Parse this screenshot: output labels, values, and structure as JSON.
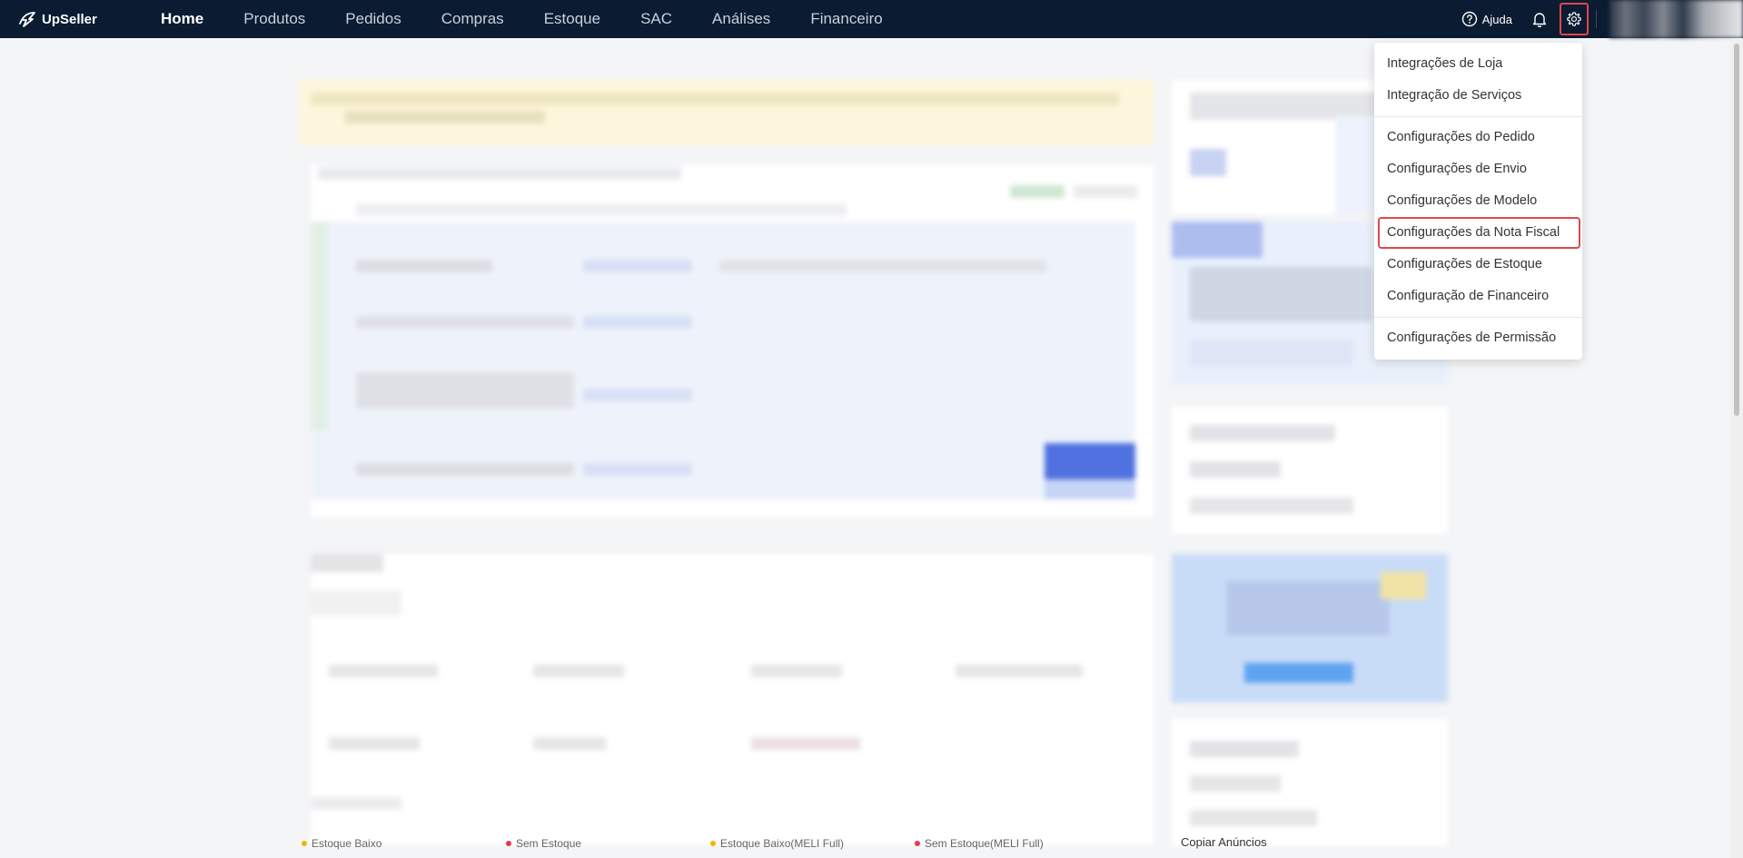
{
  "app": {
    "brand": "UpSeller"
  },
  "nav": {
    "items": [
      {
        "label": "Home",
        "active": true
      },
      {
        "label": "Produtos",
        "active": false
      },
      {
        "label": "Pedidos",
        "active": false
      },
      {
        "label": "Compras",
        "active": false
      },
      {
        "label": "Estoque",
        "active": false
      },
      {
        "label": "SAC",
        "active": false
      },
      {
        "label": "Análises",
        "active": false
      },
      {
        "label": "Financeiro",
        "active": false
      }
    ]
  },
  "topbar": {
    "help_label": "Ajuda"
  },
  "settings_menu": {
    "groups": [
      [
        "Integrações de Loja",
        "Integração de Serviços"
      ],
      [
        "Configurações do Pedido",
        "Configurações de Envio",
        "Configurações de Modelo",
        "Configurações da Nota Fiscal",
        "Configurações de Estoque",
        "Configuração de Financeiro"
      ],
      [
        "Configurações de Permissão"
      ]
    ],
    "highlighted": "Configurações da Nota Fiscal"
  },
  "legend": {
    "items": [
      {
        "label": "Estoque Baixo",
        "color": "#f5b400"
      },
      {
        "label": "Sem Estoque",
        "color": "#e8384f"
      },
      {
        "label": "Estoque Baixo(MELI Full)",
        "color": "#f5b400"
      },
      {
        "label": "Sem Estoque(MELI Full)",
        "color": "#e8384f"
      }
    ]
  },
  "side_link": {
    "label": "Copiar Anúncios"
  },
  "colors": {
    "topbar": "#0b1b32",
    "highlight_border": "#e0474c"
  }
}
